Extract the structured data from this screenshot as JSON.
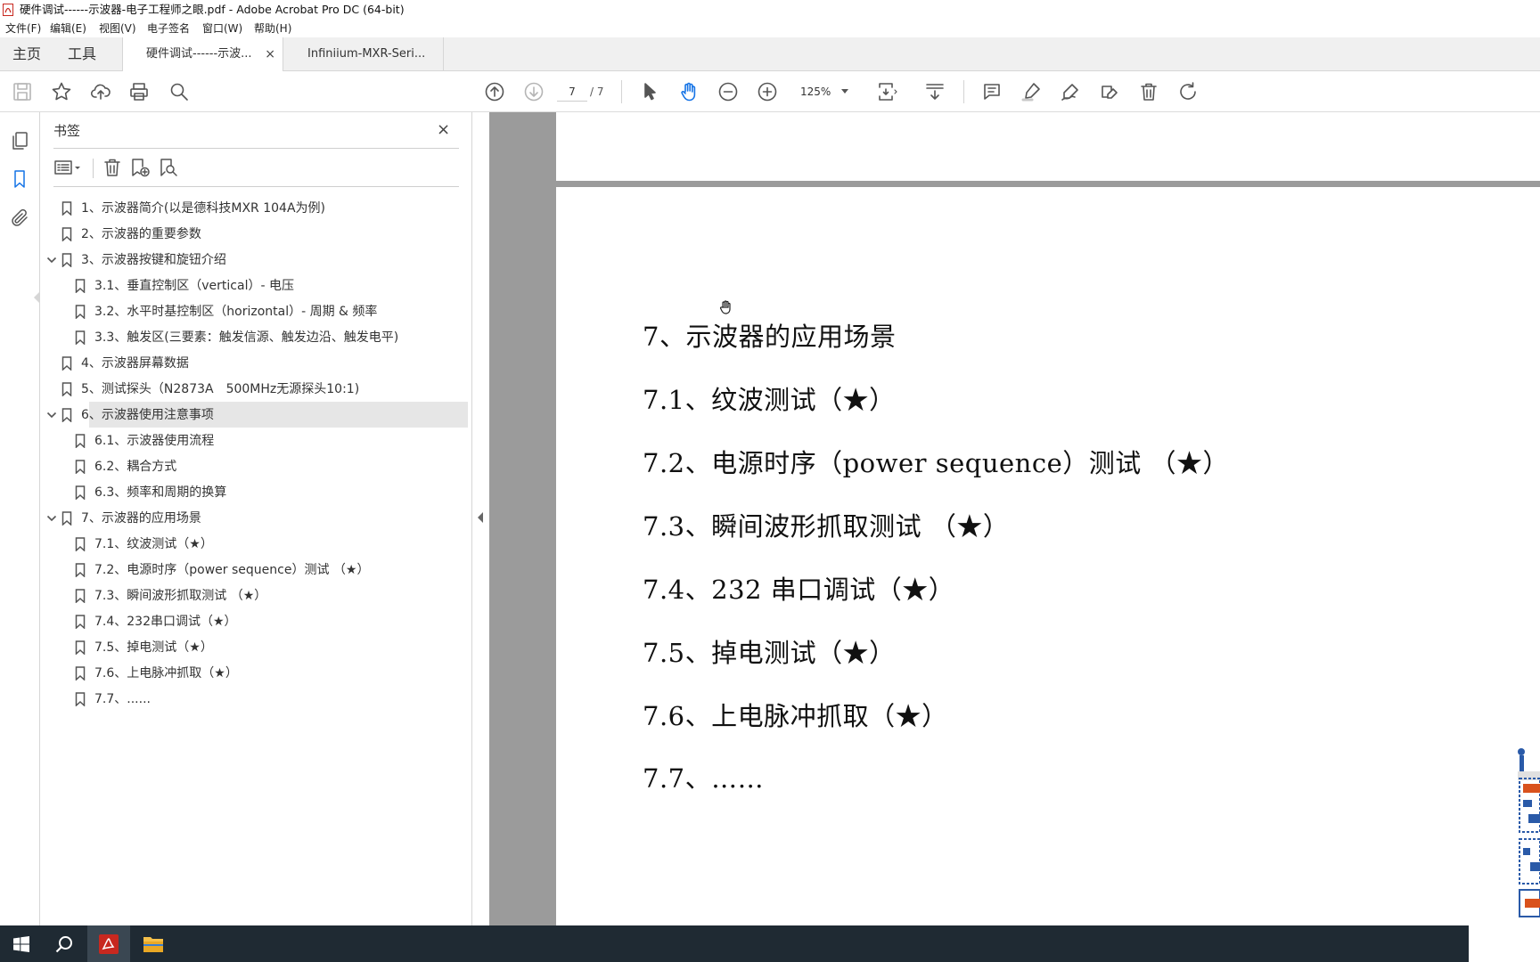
{
  "window": {
    "title": "硬件调试------示波器-电子工程师之眼.pdf - Adobe Acrobat Pro DC (64-bit)"
  },
  "menu": [
    "文件(F)",
    "编辑(E)",
    "视图(V)",
    "电子签名",
    "窗口(W)",
    "帮助(H)"
  ],
  "tabs": {
    "home": "主页",
    "tools": "工具",
    "docs": [
      {
        "label": "硬件调试------示波...",
        "active": true,
        "close": "×"
      },
      {
        "label": "Infiniium-MXR-Seri...",
        "active": false
      }
    ]
  },
  "toolbar": {
    "page_current": "7",
    "page_total": "/ 7",
    "zoom": "125%"
  },
  "bookmarks": {
    "title": "书签",
    "close": "×",
    "items": [
      {
        "label": "1、示波器简介(以是德科技MXR 104A为例)",
        "level": 0,
        "expanded": null,
        "selected": false
      },
      {
        "label": "2、示波器的重要参数",
        "level": 0,
        "expanded": null,
        "selected": false
      },
      {
        "label": "3、示波器按键和旋钮介绍",
        "level": 0,
        "expanded": true,
        "selected": false
      },
      {
        "label": "3.1、垂直控制区（vertical）- 电压",
        "level": 1,
        "expanded": null,
        "selected": false
      },
      {
        "label": "3.2、水平时基控制区（horizontal）- 周期 & 频率",
        "level": 1,
        "expanded": null,
        "selected": false
      },
      {
        "label": "3.3、触发区(三要素：触发信源、触发边沿、触发电平)",
        "level": 1,
        "expanded": null,
        "selected": false
      },
      {
        "label": "4、示波器屏幕数据",
        "level": 0,
        "expanded": null,
        "selected": false
      },
      {
        "label": "5、测试探头（N2873A　500MHz无源探头10:1)",
        "level": 0,
        "expanded": null,
        "selected": false
      },
      {
        "label": "6、示波器使用注意事项",
        "level": 0,
        "expanded": true,
        "selected": true
      },
      {
        "label": "6.1、示波器使用流程",
        "level": 1,
        "expanded": null,
        "selected": false
      },
      {
        "label": "6.2、耦合方式",
        "level": 1,
        "expanded": null,
        "selected": false
      },
      {
        "label": "6.3、频率和周期的换算",
        "level": 1,
        "expanded": null,
        "selected": false
      },
      {
        "label": "7、示波器的应用场景",
        "level": 0,
        "expanded": true,
        "selected": false
      },
      {
        "label": "7.1、纹波测试（★）",
        "level": 1,
        "expanded": null,
        "selected": false
      },
      {
        "label": "7.2、电源时序（power sequence）测试 （★）",
        "level": 1,
        "expanded": null,
        "selected": false
      },
      {
        "label": "7.3、瞬间波形抓取测试 （★）",
        "level": 1,
        "expanded": null,
        "selected": false
      },
      {
        "label": "7.4、232串口调试（★）",
        "level": 1,
        "expanded": null,
        "selected": false
      },
      {
        "label": "7.5、掉电测试（★）",
        "level": 1,
        "expanded": null,
        "selected": false
      },
      {
        "label": "7.6、上电脉冲抓取（★）",
        "level": 1,
        "expanded": null,
        "selected": false
      },
      {
        "label": "7.7、......",
        "level": 1,
        "expanded": null,
        "selected": false
      }
    ]
  },
  "document": {
    "lines": [
      "7、示波器的应用场景",
      "7.1、纹波测试（★）",
      "7.2、电源时序（power sequence）测试 （★）",
      "7.3、瞬间波形抓取测试 （★）",
      "7.4、232 串口调试（★）",
      "7.5、掉电测试（★）",
      "7.6、上电脉冲抓取（★）",
      "7.7、……"
    ]
  },
  "colors": {
    "accent": "#1473e6",
    "taskbar": "#1f2a33",
    "acrobat_red": "#c8281f",
    "doc_background": "#9b9b9b"
  }
}
